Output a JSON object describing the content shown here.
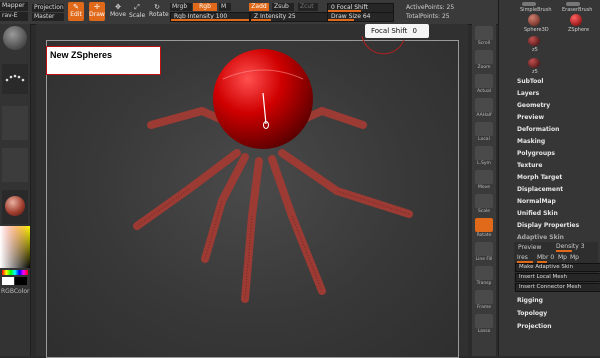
{
  "topbar": {
    "mapper_label": "Mapper",
    "mapper_sub": "rav-E",
    "projection_label": "Projection",
    "projection_sub": "Master",
    "edit_label": "Edit",
    "draw_label": "Draw",
    "move_label": "Move",
    "scale_label": "Scale",
    "rotate_label": "Rotate",
    "mrgb_label": "Mrgb",
    "rgb_label": "Rgb",
    "m_label": "M",
    "zadd_label": "Zadd",
    "zsub_label": "Zsub",
    "zcut_label": "Zcut",
    "rgb_intensity_label": "Rgb Intensity",
    "rgb_intensity_value": "100",
    "z_intensity_label": "Z Intensity",
    "z_intensity_value": "25",
    "focal_shift_label": "Focal Shift",
    "focal_shift_value": "0",
    "draw_size_label": "Draw Size",
    "draw_size_value": "64",
    "active_points_label": "ActivePoints:",
    "active_points_value": "25",
    "total_points_label": "TotalPoints:",
    "total_points_value": "25"
  },
  "left": {
    "rgb_color_label": "RGBColor"
  },
  "viewport": {
    "note_title": "New ZSpheres"
  },
  "tooltip": {
    "label": "Focal Shift",
    "value": "0"
  },
  "right_tools": [
    "Scroll",
    "Zoom",
    "Actual",
    "AAHalf",
    "Local",
    "L.Sym",
    "Move",
    "Scale",
    "Rotate",
    "Line Fill",
    "Transp",
    "Frame",
    "Lasso"
  ],
  "tool_thumbs": [
    "SimpleBrush",
    "EraserBrush",
    "Sphere3D",
    "ZSphere",
    "z5",
    "z5"
  ],
  "menu": [
    "SubTool",
    "Layers",
    "Geometry",
    "Preview",
    "Deformation",
    "Masking",
    "Polygroups",
    "Texture",
    "Morph Target",
    "Displacement",
    "NormalMap",
    "Unified Skin",
    "Display Properties",
    "Adaptive Skin"
  ],
  "adaptive": {
    "preview_label": "Preview",
    "density_label": "Density",
    "density_value": "3",
    "ires_label": "Ires",
    "mbr_label": "Mbr",
    "mbr_value": "0",
    "mp_label": "Mp",
    "mp2_label": "Mp",
    "make_skin": "Make Adaptive Skin",
    "insert_local": "Insert Local Mesh",
    "insert_connector": "Insert Connector Mesh"
  },
  "menu_bottom": [
    "Rigging",
    "Topology",
    "Projection"
  ],
  "colors": {
    "accent": "#e06a1a",
    "sphere": "#c80000",
    "limb": "#8f2e2a"
  }
}
